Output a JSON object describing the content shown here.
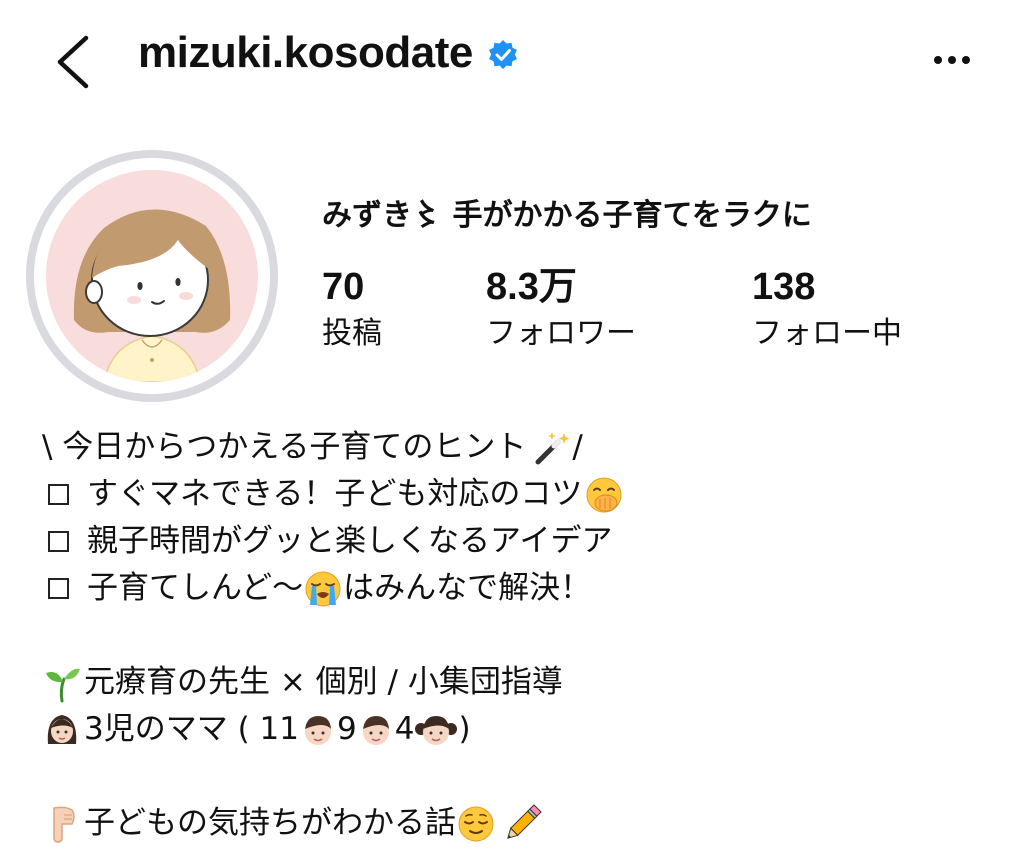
{
  "header": {
    "username": "mizuki.kosodate",
    "back_icon": "chevron-left-icon",
    "verified_icon": "verified-badge-icon",
    "more_icon": "more-horizontal-icon"
  },
  "profile": {
    "display_name": "みずき〻 手がかかる子育てをラクに",
    "stats": [
      {
        "value": "70",
        "label": "投稿"
      },
      {
        "value": "8.3万",
        "label": "フォロワー"
      },
      {
        "value": "138",
        "label": "フォロー中"
      }
    ]
  },
  "bio": {
    "line1": {
      "before": "\\ 今日からつかえる子育てのヒント",
      "icon": "magic-wand-icon",
      "after": " /"
    },
    "line2": {
      "text": "すぐマネできる！子ども対応のコツ",
      "icon": "hand-over-mouth-face-icon"
    },
    "line3": {
      "text": "親子時間がグッと楽しくなるアイデア"
    },
    "line4": {
      "before": "子育てしんど〜",
      "icon": "loudly-crying-face-icon",
      "after": "はみんなで解決！"
    },
    "line5": {
      "icon": "seedling-icon",
      "text": " 元療育の先生 × 個別 / 小集団指導"
    },
    "line6": {
      "icon": "woman-icon",
      "part1": " 3児のママ ( 11",
      "icon_a": "boy-icon",
      "part2": "9",
      "icon_b": "boy-icon",
      "part3": "4",
      "icon_c": "girl-icon",
      "part4": " )"
    },
    "line7": {
      "icon": "pointing-down-icon",
      "text": "子どもの気持ちがわかる話",
      "icon_a": "relieved-face-icon",
      "icon_b": "pencil-icon"
    }
  },
  "colors": {
    "verified_blue": "#1f93f5",
    "avatar_bg": "#f9dcdc",
    "ring": "#d9dadf",
    "hair": "#c29a6f"
  }
}
